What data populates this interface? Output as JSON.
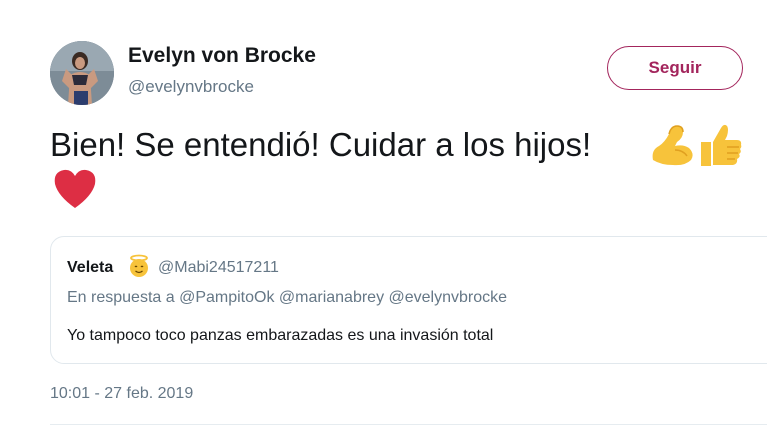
{
  "author": {
    "name": "Evelyn von Brocke",
    "handle": "@evelynvbrocke",
    "avatar_icon": "profile-photo"
  },
  "follow_button": {
    "label": "Seguir",
    "color": "#a3255c"
  },
  "tweet": {
    "text": "Bien! Se entendió! Cuidar a los hijos!",
    "emojis": [
      "flexed-biceps-icon",
      "thumbs-up-icon",
      "red-heart-icon"
    ],
    "timestamp": "10:01 - 27 feb. 2019"
  },
  "quoted_tweet": {
    "name": "Veleta",
    "name_emoji": "angel-face-icon",
    "handle": "@Mabi24517211",
    "reply_to": "En respuesta a @PampitoOk @marianabrey @evelynvbrocke",
    "text": "Yo tampoco toco panzas embarazadas es una invasión total"
  },
  "colors": {
    "text_primary": "#14171a",
    "text_secondary": "#657786",
    "border": "#e1e8ed"
  }
}
